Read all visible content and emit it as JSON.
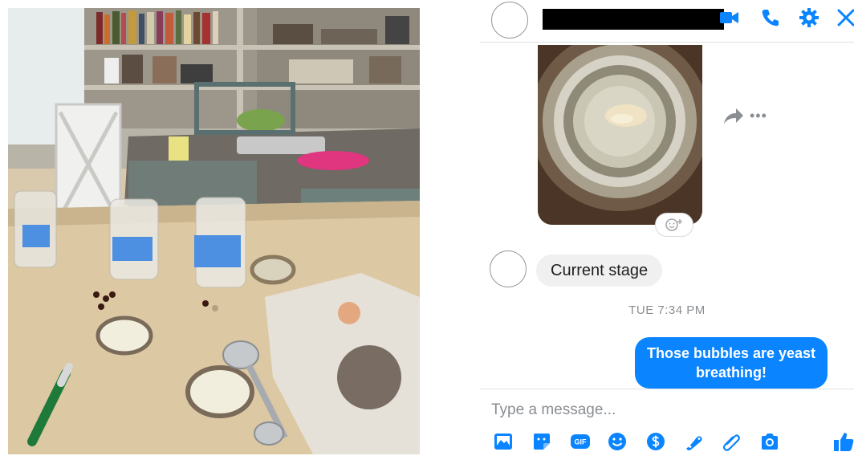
{
  "chat": {
    "header": {
      "video_icon": "video-camera-icon",
      "call_icon": "phone-icon",
      "settings_icon": "gear-icon",
      "close_icon": "close-icon"
    },
    "messages": {
      "incoming_text": "Current stage",
      "timestamp": "TUE 7:34 PM",
      "outgoing_text": "Those bubbles are yeast breathing!"
    },
    "composer": {
      "placeholder": "Type a message...",
      "toolbar_icons": [
        "image-icon",
        "sticker-icon",
        "gif-icon",
        "emoji-icon",
        "payment-icon",
        "game-icon",
        "attachment-icon",
        "camera-icon",
        "like-icon"
      ]
    }
  },
  "colors": {
    "accent": "#0a84ff",
    "incoming_bubble": "#f1f0f0",
    "muted_text": "#8a8d91"
  }
}
